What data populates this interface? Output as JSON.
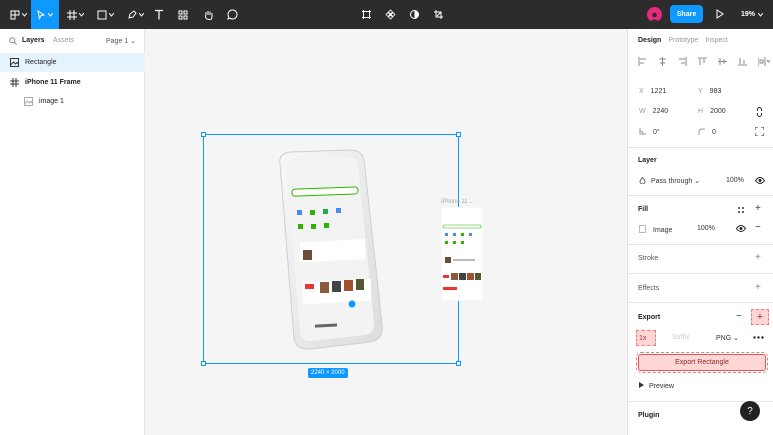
{
  "toolbar": {
    "share_label": "Share",
    "zoom_label": "19%"
  },
  "layers_panel": {
    "tab_layers": "Layers",
    "tab_assets": "Assets",
    "page_label": "Page 1 ⌄",
    "items": [
      {
        "label": "Rectangle",
        "selected": true
      },
      {
        "label": "iPhone 11 Frame",
        "selected": false
      },
      {
        "label": "image 1",
        "selected": false
      }
    ]
  },
  "canvas": {
    "dimension_badge": "2240 × 2000",
    "frame_label": "iPhone 11 ..."
  },
  "design_panel": {
    "tabs": [
      "Design",
      "Prototype",
      "Inspect"
    ],
    "x_key": "X",
    "x_value": "1221",
    "y_key": "Y",
    "y_value": "983",
    "w_key": "W",
    "w_value": "2240",
    "h_key": "H",
    "h_value": "2000",
    "rotation_value": "0°",
    "radius_value": "0",
    "layer_title": "Layer",
    "blend_mode": "Pass through ⌄",
    "layer_opacity": "100%",
    "fill_title": "Fill",
    "fill_type": "Image",
    "fill_opacity": "100%",
    "stroke_title": "Stroke",
    "effects_title": "Effects",
    "export_title": "Export",
    "export_scale": "1x",
    "export_suffix_placeholder": "Suffix",
    "export_format": "PNG ⌄",
    "export_button": "Export Rectangle",
    "preview_label": "Preview",
    "plugin_title": "Plugin",
    "help_label": "?"
  },
  "colors": {
    "toolbar_bg": "#2c2c2c",
    "accent": "#0d99ff",
    "selection_bg": "#e5f3ff",
    "highlight": "#ffd6d6"
  }
}
